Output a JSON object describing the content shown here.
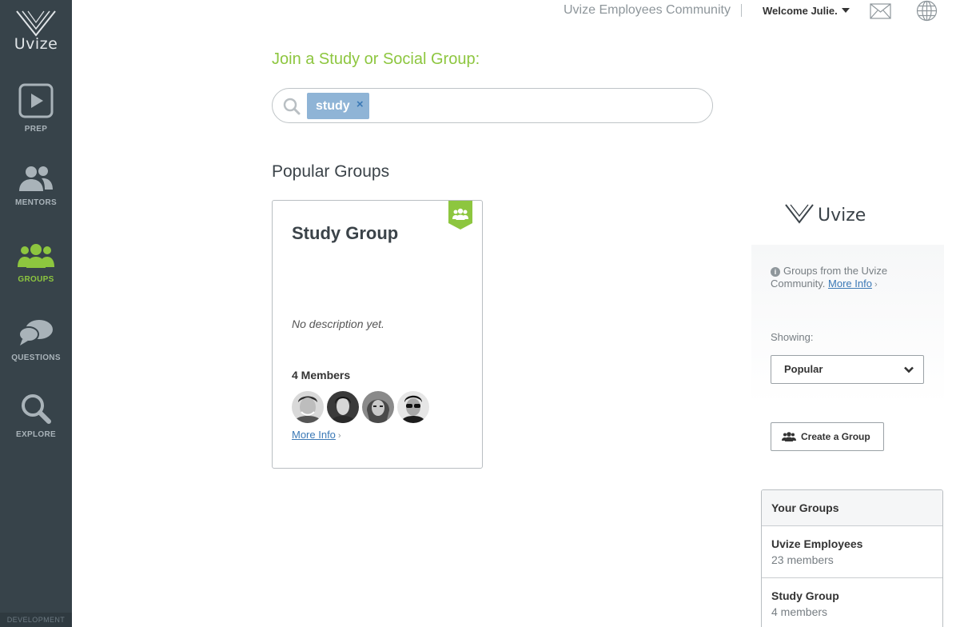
{
  "app": {
    "name": "Uvize"
  },
  "sidebar": {
    "items": [
      {
        "label": "PREP",
        "icon": "play-icon",
        "active": false
      },
      {
        "label": "MENTORS",
        "icon": "mentors-icon",
        "active": false
      },
      {
        "label": "GROUPS",
        "icon": "groups-icon",
        "active": true
      },
      {
        "label": "QUESTIONS",
        "icon": "questions-icon",
        "active": false
      },
      {
        "label": "EXPLORE",
        "icon": "explore-icon",
        "active": false
      }
    ],
    "footer": "DEVELOPMENT"
  },
  "topbar": {
    "community": "Uvize Employees Community",
    "welcome": "Welcome Julie."
  },
  "main": {
    "join_title": "Join a Study or Social Group:",
    "search": {
      "token": "study",
      "token_close": "×"
    },
    "popular_title": "Popular Groups",
    "group_card": {
      "title": "Study Group",
      "description": "No description yet.",
      "members": "4 Members",
      "more_info": "More Info"
    }
  },
  "right_panel": {
    "brand": "Uvize",
    "info_text": "Groups from the Uvize Community.",
    "info_link": "More Info",
    "showing_label": "Showing:",
    "showing_value": "Popular",
    "create_button": "Create a Group",
    "your_groups": {
      "header": "Your Groups",
      "items": [
        {
          "name": "Uvize Employees",
          "count": "23 members"
        },
        {
          "name": "Study Group",
          "count": "4 members"
        }
      ]
    }
  },
  "colors": {
    "sidebar_bg": "#37434a",
    "accent_green": "#8dc63f",
    "link_blue": "#3b79b6",
    "token_blue": "#8fb4d6"
  }
}
